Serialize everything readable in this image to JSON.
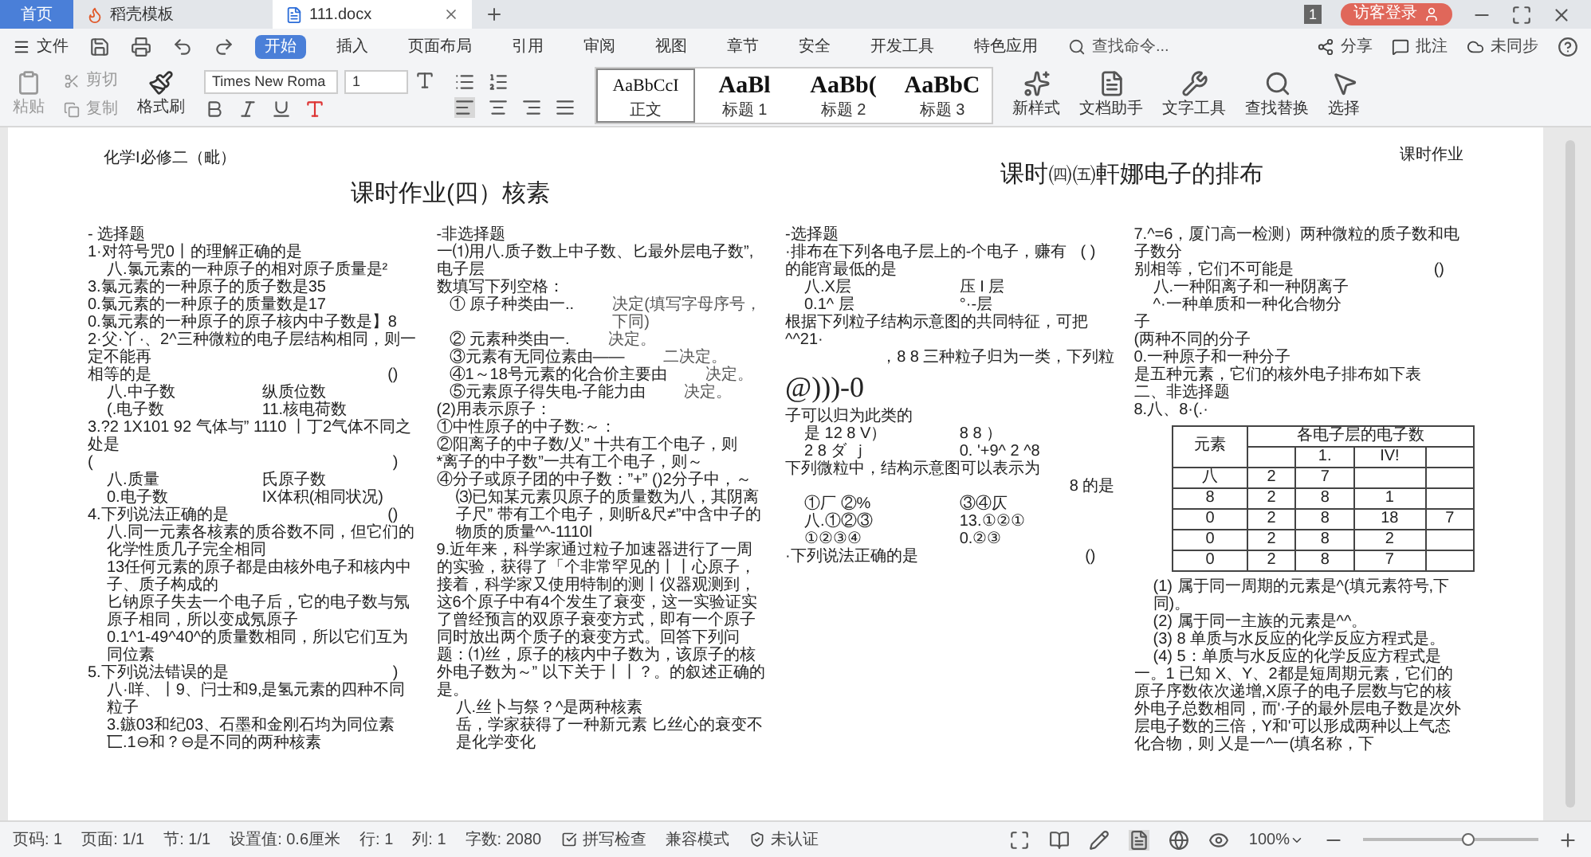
{
  "tabs": [
    {
      "label": "首页",
      "kind": "home",
      "selected": false
    },
    {
      "label": "稻壳模板",
      "kind": "template",
      "selected": false
    },
    {
      "label": "111.docx",
      "kind": "doc",
      "selected": true
    }
  ],
  "title_bar": {
    "badge": "1",
    "login": "访客登录"
  },
  "menu": {
    "file": "文件",
    "tabs": [
      {
        "label": "开始",
        "selected": true
      },
      {
        "label": "插入",
        "selected": false
      },
      {
        "label": "页面布局",
        "selected": false
      },
      {
        "label": "引用",
        "selected": false
      },
      {
        "label": "审阅",
        "selected": false
      },
      {
        "label": "视图",
        "selected": false
      },
      {
        "label": "章节",
        "selected": false
      },
      {
        "label": "安全",
        "selected": false
      },
      {
        "label": "开发工具",
        "selected": false
      },
      {
        "label": "特色应用",
        "selected": false
      }
    ],
    "search": "查找命令...",
    "right": [
      "分享",
      "批注",
      "未同步"
    ]
  },
  "ribbon": {
    "paste": "粘贴",
    "cut": "剪切",
    "copy": "复制",
    "format_painter": "格式刷",
    "font": "Times New Roma",
    "size": "1",
    "styles": [
      {
        "sample": "AaBbCcI",
        "label": "正文",
        "selected": true
      },
      {
        "sample": "AaBl",
        "label": "标题 1",
        "selected": false
      },
      {
        "sample": "AaBb(",
        "label": "标题 2",
        "selected": false
      },
      {
        "sample": "AaBbC",
        "label": "标题 3",
        "selected": false
      }
    ],
    "tools": [
      {
        "kind": "style",
        "label": "新样式"
      },
      {
        "kind": "assistant",
        "label": "文档助手"
      },
      {
        "kind": "text",
        "label": "文字工具"
      },
      {
        "kind": "find",
        "label": "查找替换"
      },
      {
        "kind": "select",
        "label": "选择"
      }
    ]
  },
  "document": {
    "header_left": "化学I必修二（毗）",
    "header_right": "课时作业",
    "title_1": "课时作业(四）核素",
    "title_2": "课时㈣㈤軒娜电子的排布",
    "columns": [
      [
        {
          "kind": "line",
          "text": "- 选择题"
        },
        {
          "kind": "line",
          "text": "1·对符号咒0丨的理解正确的是"
        },
        {
          "kind": "option",
          "text": "八.氯元素的一种原子的相对原子质量是²"
        },
        {
          "kind": "line",
          "text": "3.氯元素的一种原子的质子数是35"
        },
        {
          "kind": "line",
          "text": "0.氯元素的一种原子的质量数是17"
        },
        {
          "kind": "line",
          "text": "0.氯元素的一种原子的原子核内中子数是】8"
        },
        {
          "kind": "line",
          "text": "2·父·丫·、2^三种微粒的电子层结构相同，则一定不能再"
        },
        {
          "kind": "ask",
          "texts": [
            "相等的是",
            "()"
          ]
        },
        {
          "kind": "pair",
          "texts": [
            "八.中子数",
            "纵质位数"
          ]
        },
        {
          "kind": "pair",
          "texts": [
            "(.电子数",
            "11.核电荷数"
          ]
        },
        {
          "kind": "line",
          "text": "3.?2 1X101 92 气体与” 1110 丨丁2气体不同之处是"
        },
        {
          "kind": "ask",
          "texts": [
            "(",
            ")"
          ]
        },
        {
          "kind": "pair",
          "texts": [
            "八.质量",
            "氏原子数"
          ]
        },
        {
          "kind": "pair",
          "texts": [
            "0.电子数",
            "IX体积(相同状况)"
          ]
        },
        {
          "kind": "ask",
          "texts": [
            "4.下列说法正确的是",
            "()"
          ]
        },
        {
          "kind": "option",
          "text": "八.同一元素各核素的质谷数不同，但它们的化学性质几子完全相同"
        },
        {
          "kind": "option",
          "text": "13任何元素的原子都是由核外电子和核内中子、质子构成的"
        },
        {
          "kind": "option",
          "text": "匕钠原子失去一个电子后，它的电子数与氖原子相同，所以变成氖原子"
        },
        {
          "kind": "option",
          "text": "0.1^1-49^40^的质量数相同，所以它们互为同位素"
        },
        {
          "kind": "ask",
          "texts": [
            "5.下列说法错误的是",
            ")"
          ]
        },
        {
          "kind": "option",
          "text": "八·咩、丨9、闩士和9,是氢元素的四种不同粒子"
        },
        {
          "kind": "option",
          "text": "3.鏃03和纪03、石墨和金刚石均为同位素"
        },
        {
          "kind": "option",
          "text": "匸.1⊖和？⊖是不同的两种核素"
        }
      ],
      [
        {
          "kind": "line",
          "text": "-非选择题"
        },
        {
          "kind": "line",
          "text": "一⑴用八.质子数上中子数、匕最外层电子数”,电子层"
        },
        {
          "kind": "line",
          "text": "数填写下列空格："
        },
        {
          "kind": "blank",
          "texts": [
            "① 原子种类由一..",
            "决定(填写字母序号，下同)"
          ]
        },
        {
          "kind": "blank",
          "texts": [
            "② 元素种类由一.",
            "决定。"
          ]
        },
        {
          "kind": "blank",
          "texts": [
            "③元素有无同位素由——",
            "二决定。"
          ]
        },
        {
          "kind": "blank",
          "texts": [
            "④1～18号元素的化合价主要由",
            "决定。"
          ]
        },
        {
          "kind": "blank",
          "texts": [
            "⑤元素原子得失电-子能力由",
            "决定。"
          ]
        },
        {
          "kind": "line",
          "text": "(2)用表示原子："
        },
        {
          "kind": "line",
          "text": "①中性原子的中子数:～："
        },
        {
          "kind": "line",
          "text": "②阳离子的中子数/乂” 十共有工个电子，则"
        },
        {
          "kind": "line",
          "text": "*离子的中子数”一共有工个电子，则～"
        },
        {
          "kind": "line",
          "text": "④分子或原子团的中子数：”+” ()2分子中，～"
        },
        {
          "kind": "option",
          "text": "⑶已知某元素贝原子的质量数为八，其阴离子尺” 带有工个电子，则昕&尺≠”中含中子的物质的质量^^-1110l"
        },
        {
          "kind": "line",
          "text": "9.近年来，科学家通过粒子加速器进行了一周的实验，获得了「个非常罕见的丨丨心原子，接着，科学家又使用特制的测丨仪器观测到，这6个原子中有4个发生了衰变，这一实验证实了曾经预言的双原子衰变方式，即有一个原子同时放出两个质子的衰变方式。回答下列问题：⑴丝，原子的核内中子数为，该原子的核外电子数为～” 以下关于丨丨？。的叙述正确的是。"
        },
        {
          "kind": "option",
          "text": "八.丝卜与祭？^是两种核素"
        },
        {
          "kind": "option",
          "text": "岳，学家获得了一种新元素 匕丝心的衰变不是化学变化"
        }
      ],
      [
        {
          "kind": "line",
          "text": "-选择题"
        },
        {
          "kind": "ask",
          "texts": [
            "·排布在下列各电子层上的-个电子，赚有的能宵最低的是",
            "( )"
          ]
        },
        {
          "kind": "pair",
          "texts": [
            "八.X层",
            "压 I 层"
          ]
        },
        {
          "kind": "pair",
          "texts": [
            "0.1^ 层",
            "°·-层"
          ]
        },
        {
          "kind": "line",
          "text": "根据下列粒子结构示意图的共同特征，可把^^21·"
        },
        {
          "kind": "right",
          "text": "，8 8 三种粒子归为一类，下列粒"
        },
        {
          "kind": "big",
          "text": "@)))-0"
        },
        {
          "kind": "line",
          "text": "子可以归为此类的"
        },
        {
          "kind": "pair",
          "texts": [
            "是  12 8 V）",
            "8 8 ）"
          ]
        },
        {
          "kind": "pair",
          "texts": [
            "2 8 ダ ｊ",
            "0.  '+9^ 2 ^8"
          ]
        },
        {
          "kind": "line",
          "text": "下列微粒中，结构示意图可以表示为"
        },
        {
          "kind": "right",
          "text": "8 的是"
        },
        {
          "kind": "pair",
          "texts": [
            "①厂 ②%",
            "③④仄"
          ]
        },
        {
          "kind": "pair",
          "texts": [
            "八.①②③",
            "13.①②①"
          ]
        },
        {
          "kind": "pair",
          "texts": [
            "①②③④",
            "0.②③"
          ]
        },
        {
          "kind": "ask",
          "texts": [
            "·下列说法正确的是",
            "()"
          ]
        }
      ],
      [
        {
          "kind": "line",
          "text": "7.^=6，厦门高一检测）两种微粒的质子数和电子数分"
        },
        {
          "kind": "ask",
          "texts": [
            "别相等，它们不可能是",
            "()"
          ]
        },
        {
          "kind": "option",
          "text": "八.一种阳离子和一种阴离子"
        },
        {
          "kind": "option",
          "text": "^·一种单质和一种化合物分"
        },
        {
          "kind": "line",
          "text": "子"
        },
        {
          "kind": "line",
          "text": "(两种不同的分子"
        },
        {
          "kind": "line",
          "text": "0.一种原子和一种分子"
        },
        {
          "kind": "line",
          "text": "是五种元素，它们的核外电子排布如下表"
        },
        {
          "kind": "line",
          "text": "二、非选择题"
        },
        {
          "kind": "line",
          "text": "8.八、8·(.·"
        },
        {
          "kind": "table",
          "head": "元素",
          "group": "各电子层的电子数",
          "subheads": {
            "column_2": "1.",
            "column_3": "IV!"
          },
          "rows": [
            [
              "八",
              "2",
              "7",
              null,
              null
            ],
            [
              "8",
              "2",
              "8",
              "1",
              null
            ],
            [
              "0",
              "2",
              "8",
              "18",
              "7"
            ],
            [
              "0",
              "2",
              "8",
              "2",
              null
            ],
            [
              "0",
              "2",
              "8",
              "7",
              null
            ]
          ]
        },
        {
          "kind": "option",
          "text": "(1) 属于同一周期的元素是^(填元素符号,下同)。"
        },
        {
          "kind": "option",
          "text": "(2) 属于同一主族的元素是^^。"
        },
        {
          "kind": "option",
          "text": "(3) 8 单质与水反应的化学反应方程式是。"
        },
        {
          "kind": "option",
          "text": "(4) 5：单质与水反应的化学反应方程式是"
        },
        {
          "kind": "line",
          "text": "一。1 已知 X、Y、2都是短周期元素，它们的原子序数依次递增,X原子的电子层数与它的核外电子总数相同，而'·子的最外层电子数是次外层电子数的三倍，Y和'可以形成两种以上气态化合物，则 乂是一^一(填名称，下"
        }
      ]
    ]
  },
  "status_bar": {
    "items": [
      "页码: 1",
      "页面: 1/1",
      "节: 1/1",
      "设置值: 0.6厘米",
      "行: 1",
      "列: 1",
      "字数: 2080"
    ],
    "spell": "拼写检查",
    "compat": "兼容模式",
    "cert": "未认证",
    "zoom": "100%",
    "zoom_slider": {
      "level": 0.6
    }
  }
}
